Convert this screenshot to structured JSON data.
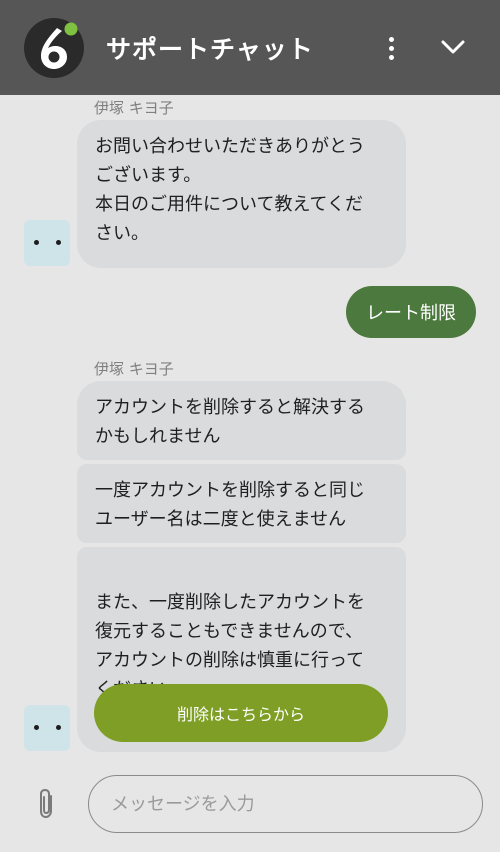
{
  "header": {
    "title": "サポートチャット",
    "logo_icon": "app-logo-icon",
    "menu_icon": "kebab-menu-icon",
    "collapse_icon": "chevron-down-icon",
    "background": "#565656"
  },
  "messages": [
    {
      "sender": "伊塚 キヨ子",
      "text": "お問い合わせいただきありがとう\nございます。\n本日のご用件について教えてくだ\nさい。"
    },
    {
      "user_text": "レート制限"
    },
    {
      "sender": "伊塚 キヨ子",
      "bubbles": [
        "アカウントを削除すると解決する\nかもしれません",
        "一度アカウントを削除すると同じ\nユーザー名は二度と使えません",
        "また、一度削除したアカウントを\n復元することもできませんので、\nアカウントの削除は慎重に行って\nください"
      ],
      "button_label": "削除はこちらから"
    }
  ],
  "composer": {
    "placeholder": "メッセージを入力",
    "attach_icon": "paperclip-icon"
  },
  "colors": {
    "agent_bubble": "#d9dbdd",
    "user_bubble": "#4c7a3e",
    "cta_button": "#7f9e25",
    "avatar": "#cfe4e8"
  }
}
